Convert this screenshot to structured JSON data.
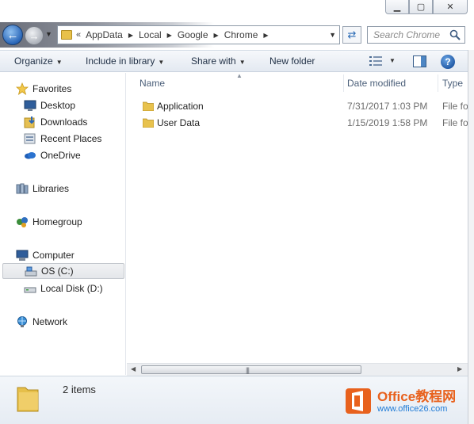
{
  "window": {
    "controls": {
      "minimize": "▁",
      "maximize": "▢",
      "close": "✕"
    }
  },
  "address_bar": {
    "overflow": "«",
    "breadcrumbs": [
      "AppData",
      "Local",
      "Google",
      "Chrome"
    ],
    "separator_icon": "chevron-right-icon"
  },
  "search": {
    "placeholder": "Search Chrome",
    "icon": "search-icon"
  },
  "toolbar": {
    "organize": "Organize",
    "include_in_library": "Include in library",
    "share_with": "Share with",
    "new_folder": "New folder",
    "help": "?"
  },
  "nav_pane": {
    "favorites": {
      "label": "Favorites",
      "items": [
        {
          "label": "Desktop",
          "icon": "desktop-icon"
        },
        {
          "label": "Downloads",
          "icon": "downloads-icon"
        },
        {
          "label": "Recent Places",
          "icon": "recent-places-icon"
        },
        {
          "label": "OneDrive",
          "icon": "onedrive-icon"
        }
      ]
    },
    "libraries": {
      "label": "Libraries"
    },
    "homegroup": {
      "label": "Homegroup"
    },
    "computer": {
      "label": "Computer",
      "items": [
        {
          "label": "OS (C:)",
          "icon": "drive-c-icon",
          "selected": true
        },
        {
          "label": "Local Disk (D:)",
          "icon": "drive-d-icon",
          "selected": false
        }
      ]
    },
    "network": {
      "label": "Network"
    }
  },
  "columns": {
    "name": "Name",
    "date_modified": "Date modified",
    "type": "Type"
  },
  "files": [
    {
      "name": "Application",
      "date_modified": "7/31/2017 1:03 PM",
      "type": "File fo"
    },
    {
      "name": "User Data",
      "date_modified": "1/15/2019 1:58 PM",
      "type": "File fo"
    }
  ],
  "status": {
    "item_count": "2 items"
  },
  "watermark": {
    "brand_latin": "Office",
    "brand_cn": "教程网",
    "url": "www.office26.com"
  },
  "colors": {
    "accent": "#2a66b8",
    "toolbar_text": "#1f2f45",
    "watermark_orange": "#e8611d",
    "watermark_blue": "#1f7bd6"
  }
}
